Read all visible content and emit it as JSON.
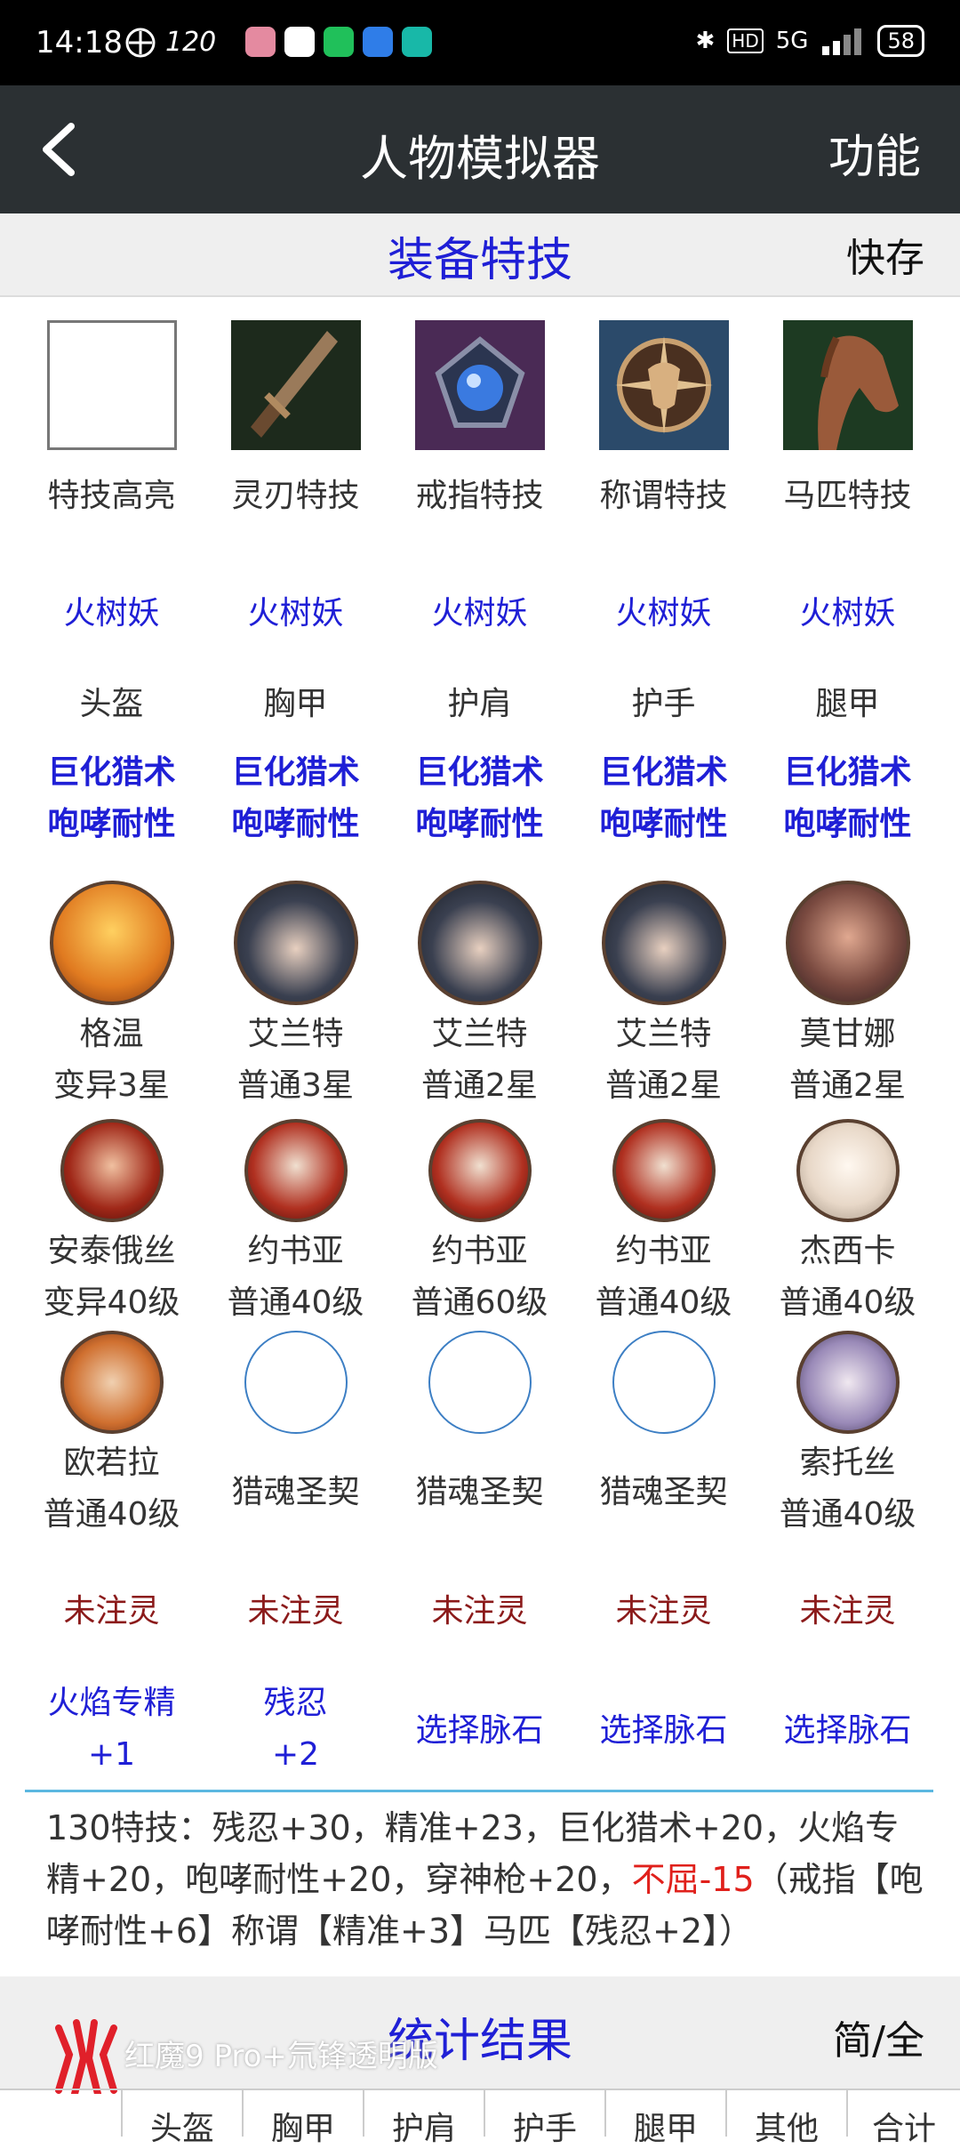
{
  "status": {
    "time": "14:18",
    "refresh_rate": "120",
    "network": "5G",
    "hd": "HD",
    "battery": "58"
  },
  "appbar": {
    "title": "人物模拟器",
    "func_label": "功能"
  },
  "equip_section": {
    "title": "装备特技",
    "right_label": "快存"
  },
  "skill_slots": [
    {
      "label": "特技高亮",
      "icon": "blank-icon"
    },
    {
      "label": "灵刃特技",
      "icon": "dagger-icon"
    },
    {
      "label": "戒指特技",
      "icon": "ring-gem-icon"
    },
    {
      "label": "称谓特技",
      "icon": "emblem-icon"
    },
    {
      "label": "马匹特技",
      "icon": "horse-icon"
    }
  ],
  "monsters": [
    "火树妖",
    "火树妖",
    "火树妖",
    "火树妖",
    "火树妖"
  ],
  "gear_slots": [
    "头盔",
    "胸甲",
    "护肩",
    "护手",
    "腿甲"
  ],
  "gear_skills": [
    [
      "巨化猎术",
      "咆哮耐性"
    ],
    [
      "巨化猎术",
      "咆哮耐性"
    ],
    [
      "巨化猎术",
      "咆哮耐性"
    ],
    [
      "巨化猎术",
      "咆哮耐性"
    ],
    [
      "巨化猎术",
      "咆哮耐性"
    ]
  ],
  "heroes_row1": [
    {
      "name": "格温",
      "grade": "变异3星"
    },
    {
      "name": "艾兰特",
      "grade": "普通3星"
    },
    {
      "name": "艾兰特",
      "grade": "普通2星"
    },
    {
      "name": "艾兰特",
      "grade": "普通2星"
    },
    {
      "name": "莫甘娜",
      "grade": "普通2星"
    }
  ],
  "heroes_row2": [
    {
      "name": "安泰俄丝",
      "grade": "变异40级"
    },
    {
      "name": "约书亚",
      "grade": "普通40级"
    },
    {
      "name": "约书亚",
      "grade": "普通60级"
    },
    {
      "name": "约书亚",
      "grade": "普通40级"
    },
    {
      "name": "杰西卡",
      "grade": "普通40级"
    }
  ],
  "heroes_row3": [
    {
      "name": "欧若拉",
      "grade": "普通40级"
    },
    {
      "name": "猎魂圣契",
      "grade": ""
    },
    {
      "name": "猎魂圣契",
      "grade": ""
    },
    {
      "name": "猎魂圣契",
      "grade": ""
    },
    {
      "name": "索托丝",
      "grade": "普通40级"
    }
  ],
  "infuse": [
    "未注灵",
    "未注灵",
    "未注灵",
    "未注灵",
    "未注灵"
  ],
  "veins": [
    {
      "line1": "火焰专精",
      "line2": "+1"
    },
    {
      "line1": "残忍",
      "line2": "+2"
    },
    {
      "line1": "选择脉石",
      "line2": ""
    },
    {
      "line1": "选择脉石",
      "line2": ""
    },
    {
      "line1": "选择脉石",
      "line2": ""
    }
  ],
  "summary": {
    "text_a": "130特技：残忍+30，精准+23，巨化猎术+20，火焰专精+20，咆哮耐性+20，穿神枪+20，",
    "text_neg": "不屈-15",
    "text_b": "（戒指【咆哮耐性+6】称谓【精准+3】马匹【残忍+2】）"
  },
  "stats_section": {
    "title": "统计结果",
    "right_label": "简/全"
  },
  "watermark": "红魔9 Pro+氘锋透明版",
  "table_headers": [
    "",
    "头盔",
    "胸甲",
    "护肩",
    "护手",
    "腿甲",
    "其他",
    "合计"
  ],
  "colors": {
    "accent_blue": "#1f1fd6",
    "appbar_bg": "#2b3033",
    "infuse_red": "#8b1a1a",
    "negative_red": "#e0201b",
    "divider": "#5bb7e0"
  }
}
